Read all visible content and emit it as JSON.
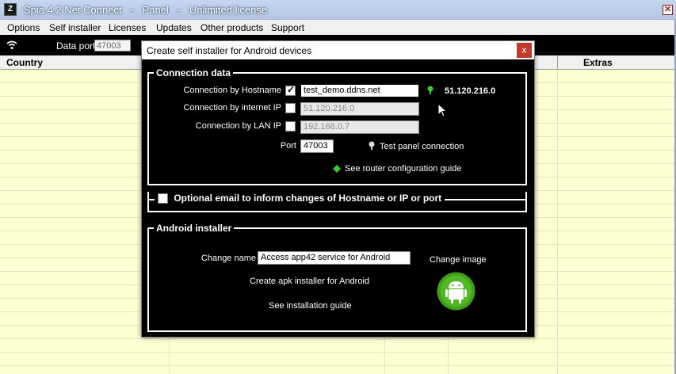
{
  "titlebar": {
    "title": "Spia 4.2 Net Connect   -   Panel   -   Unlimited license",
    "app_icon_glyph": "Z",
    "close_glyph": "✕"
  },
  "menu": {
    "items": [
      "Options",
      "Self installer",
      "Licenses",
      "Updates",
      "Other products",
      "Support"
    ]
  },
  "toolbar": {
    "data_port_label": "Data port",
    "data_port_value": "47003",
    "wifi_icon": "wifi-icon"
  },
  "grid": {
    "columns": [
      "Country",
      "Extras"
    ]
  },
  "dialog": {
    "title": "Create self installer for Android devices",
    "close_glyph": "x",
    "connection_data": {
      "legend": "Connection data",
      "hostname_label": "Connection by Hostname",
      "hostname_checked": true,
      "hostname_value": "test_demo.ddns.net",
      "hostname_ip": "51.120.216.0",
      "internet_ip_label": "Connection by internet IP",
      "internet_ip_value": "51.120.216.0",
      "lan_ip_label": "Connection by LAN IP",
      "lan_ip_value": "192.168.0.7",
      "port_label": "Port",
      "port_value": "47003",
      "test_connection_label": "Test panel connection",
      "router_guide_label": "See router configuration guide"
    },
    "optional_email": {
      "legend": "Optional email to inform changes of Hostname or IP or port"
    },
    "android_installer": {
      "legend": "Android installer",
      "change_name_label": "Change name",
      "change_name_value": "Access app42 service for Android",
      "create_apk_label": "Create apk installer for Android",
      "installation_guide_label": "See installation guide",
      "change_image_label": "Change image"
    },
    "colors": {
      "status_green": "#33cc33",
      "android_green": "#3f9e1a"
    }
  }
}
